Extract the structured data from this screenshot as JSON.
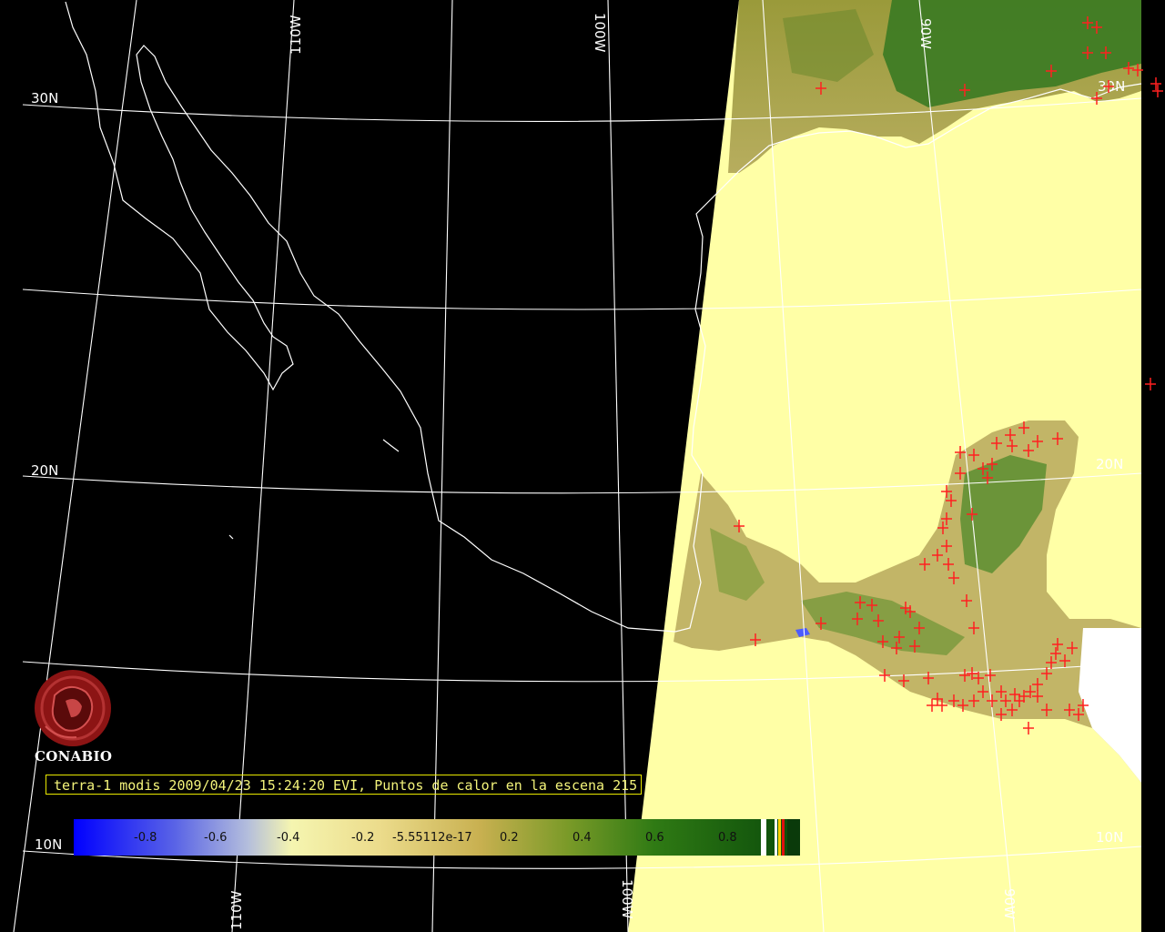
{
  "logo": {
    "name": "CONABIO"
  },
  "caption": {
    "text": "terra-1 modis 2009/04/23 15:24:20 EVI, Puntos de calor en la escena 215"
  },
  "grid_labels": {
    "lat30n": "30N",
    "lat20n_left": "20N",
    "lat20n_right": "20N",
    "lat10n_left": "10N",
    "lat10n_right": "10N",
    "lon110w_top": "110W",
    "lon100w_top": "100W",
    "lon110w_bottom": "110W",
    "lon100w_bottom": "100W",
    "lon90w_top": "90W",
    "lon90w_bottom": "90W",
    "lat30n_right": "30N"
  },
  "colorbar": {
    "labels": [
      "-0.8",
      "-0.6",
      "-0.4",
      "-0.2",
      "-5.55112e-17",
      "0.2",
      "0.4",
      "0.6",
      "0.8"
    ],
    "colors": {
      "low": "#1515ff",
      "pale": "#f5f5b0",
      "mid": "#c8b458",
      "high": "#0e5a0e"
    }
  },
  "colors": {
    "land_ocean_fill": "#ffffa6",
    "vegetation": "#3f7d1f",
    "hotspot": "#ff2020",
    "coastline": "#ffffff",
    "background": "#000000"
  }
}
